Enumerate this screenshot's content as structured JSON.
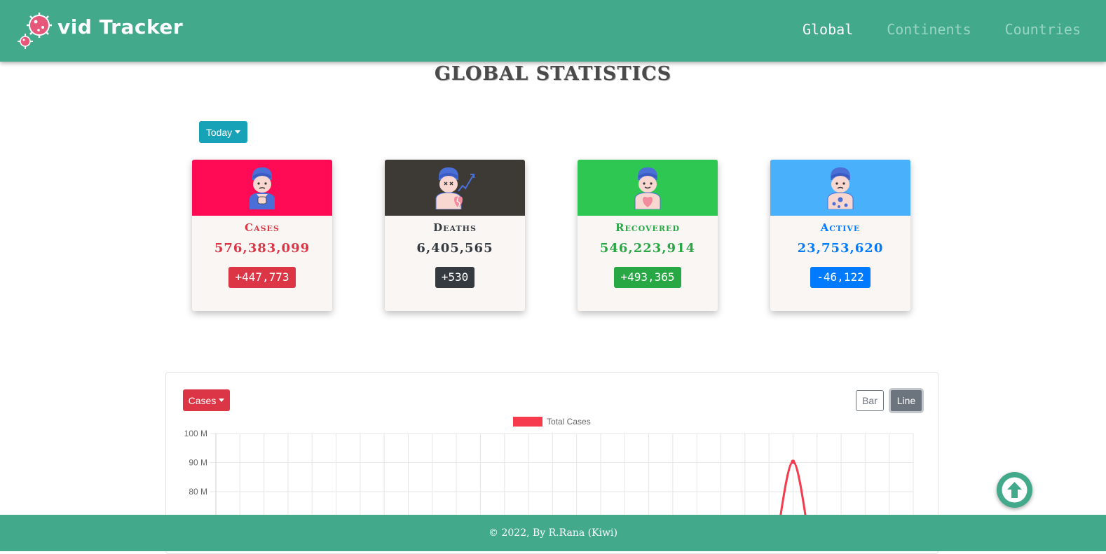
{
  "navbar": {
    "brand": "vid Tracker",
    "links": [
      {
        "label": "Global",
        "active": true
      },
      {
        "label": "Continents",
        "active": false
      },
      {
        "label": "Countries",
        "active": false
      }
    ]
  },
  "page": {
    "title": "GLOBAL STATISTICS",
    "period_dropdown": "Today"
  },
  "cards": [
    {
      "title": "Cases",
      "count": "576,383,099",
      "delta": "+447,773",
      "header_color": "#ff0a54",
      "text_color": "#dc3545",
      "delta_color": "#dc3545",
      "icon": "patient-cough-icon"
    },
    {
      "title": "Deaths",
      "count": "6,405,565",
      "delta": "+530",
      "header_color": "#3d3935",
      "text_color": "#343a40",
      "delta_color": "#343a40",
      "icon": "broken-heart-icon"
    },
    {
      "title": "Recovered",
      "count": "546,223,914",
      "delta": "+493,365",
      "header_color": "#2ec752",
      "text_color": "#28a745",
      "delta_color": "#28a745",
      "icon": "healthy-heart-icon"
    },
    {
      "title": "Active",
      "count": "23,753,620",
      "delta": "-46,122",
      "header_color": "#49b0fc",
      "text_color": "#007bff",
      "delta_color": "#007bff",
      "icon": "infected-patient-icon"
    }
  ],
  "chart_panel": {
    "metric_dropdown": "Cases",
    "bar_label": "Bar",
    "line_label": "Line",
    "active_view": "Line"
  },
  "chart_data": {
    "type": "line",
    "series": [
      {
        "name": "Total Cases",
        "color": "#f53b4d"
      }
    ],
    "y_ticks": [
      "100 M",
      "90 M",
      "80 M"
    ],
    "y_values": [
      100000000,
      90000000,
      80000000
    ],
    "grid": true,
    "legend": "top",
    "x_category_count": 29,
    "visible_points": [
      {
        "index": 23.45,
        "value": 70000000
      },
      {
        "index": 24,
        "value": 90300000
      },
      {
        "index": 24.55,
        "value": 70000000
      }
    ]
  },
  "footer": {
    "text": "© 2022, By R.Rana (Kiwi)"
  },
  "scroll_top": {
    "icon": "arrow-up-icon"
  }
}
